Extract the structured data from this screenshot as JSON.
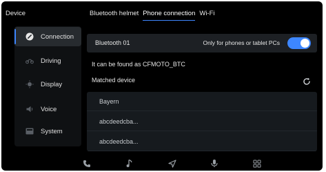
{
  "header": {
    "title": "Device"
  },
  "tabs": [
    {
      "label": "Bluetooth helmet",
      "active": false
    },
    {
      "label": "Phone connection",
      "active": true
    },
    {
      "label": "Wi-Fi",
      "active": false
    }
  ],
  "sidebar": {
    "items": [
      {
        "label": "Connection",
        "icon": "link-icon",
        "active": true
      },
      {
        "label": "Driving",
        "icon": "motorcycle-icon",
        "active": false
      },
      {
        "label": "Display",
        "icon": "sun-icon",
        "active": false
      },
      {
        "label": "Voice",
        "icon": "speaker-icon",
        "active": false
      },
      {
        "label": "System",
        "icon": "system-icon",
        "active": false
      }
    ]
  },
  "bluetooth": {
    "name": "Bluetooth 01",
    "note": "Only for phones or tablet PCs",
    "toggle_on": true
  },
  "discoverable_text": "It can be found as CFMOTO_BTC",
  "matched": {
    "title": "Matched device",
    "devices": [
      "Bayern",
      "abcdeedcba...",
      "abcdeedcba..."
    ]
  },
  "dock": {
    "icons": [
      "phone-icon",
      "music-icon",
      "navigation-icon",
      "microphone-icon",
      "grid-icon"
    ]
  },
  "colors": {
    "accent": "#3d86ff",
    "background": "#000000",
    "panel": "#1d2024"
  }
}
